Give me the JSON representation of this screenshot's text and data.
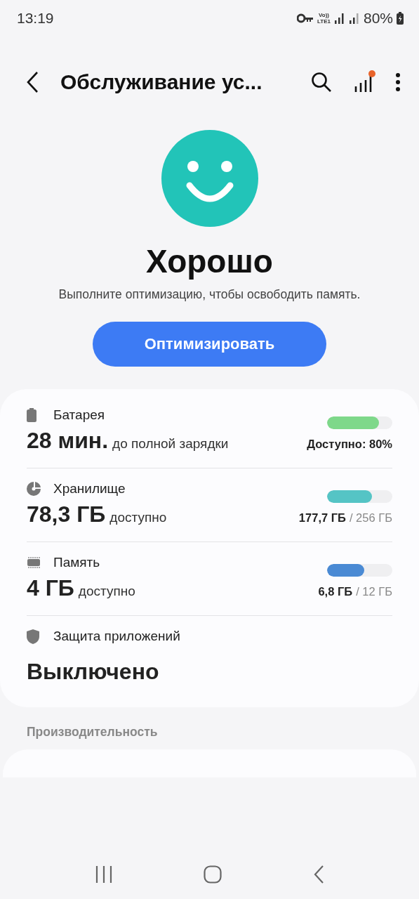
{
  "status_bar": {
    "time": "13:19",
    "network": "LTE1",
    "volte": "Vo))",
    "battery": "80%"
  },
  "app_bar": {
    "title": "Обслуживание ус...",
    "notification_dot": true
  },
  "summary": {
    "status": "Хорошо",
    "message": "Выполните оптимизацию, чтобы освободить память.",
    "button": "Оптимизировать"
  },
  "items": [
    {
      "kind": "meter",
      "title": "Батарея",
      "value": "28 мин.",
      "value_note": "до полной зарядки",
      "level": 0.8,
      "color": "#7ed88a",
      "reading": "Доступно: 80%"
    },
    {
      "kind": "meter",
      "title": "Хранилище",
      "value": "78,3 ГБ",
      "value_note": "доступно",
      "level": 0.69,
      "color": "#55c4c5",
      "reading": "177,7 ГБ",
      "reading_total": "/ 256 ГБ"
    },
    {
      "kind": "meter",
      "title": "Память",
      "value": "4 ГБ",
      "value_note": "доступно",
      "level": 0.57,
      "color": "#4a8ad4",
      "reading": "6,8 ГБ",
      "reading_total": "/ 12 ГБ"
    },
    {
      "kind": "status",
      "title": "Защита приложений",
      "value": "Выключено"
    }
  ],
  "section_header": "Производительность"
}
